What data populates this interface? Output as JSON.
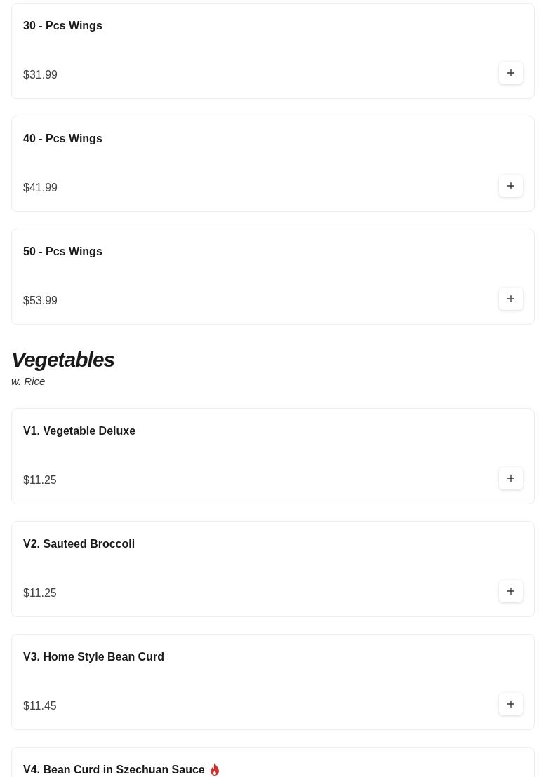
{
  "sections": [
    {
      "items": [
        {
          "name": "30 - Pcs Wings",
          "price": "$31.99",
          "spicy": false
        },
        {
          "name": "40 - Pcs Wings",
          "price": "$41.99",
          "spicy": false
        },
        {
          "name": "50 - Pcs Wings",
          "price": "$53.99",
          "spicy": false
        }
      ]
    },
    {
      "title": "Vegetables",
      "subtitle": "w. Rice",
      "items": [
        {
          "name": "V1. Vegetable Deluxe",
          "price": "$11.25",
          "spicy": false
        },
        {
          "name": "V2. Sauteed Broccoli",
          "price": "$11.25",
          "spicy": false
        },
        {
          "name": "V3. Home Style Bean Curd",
          "price": "$11.45",
          "spicy": false
        },
        {
          "name": "V4. Bean Curd in Szechuan Sauce",
          "spicy": true
        }
      ]
    }
  ]
}
